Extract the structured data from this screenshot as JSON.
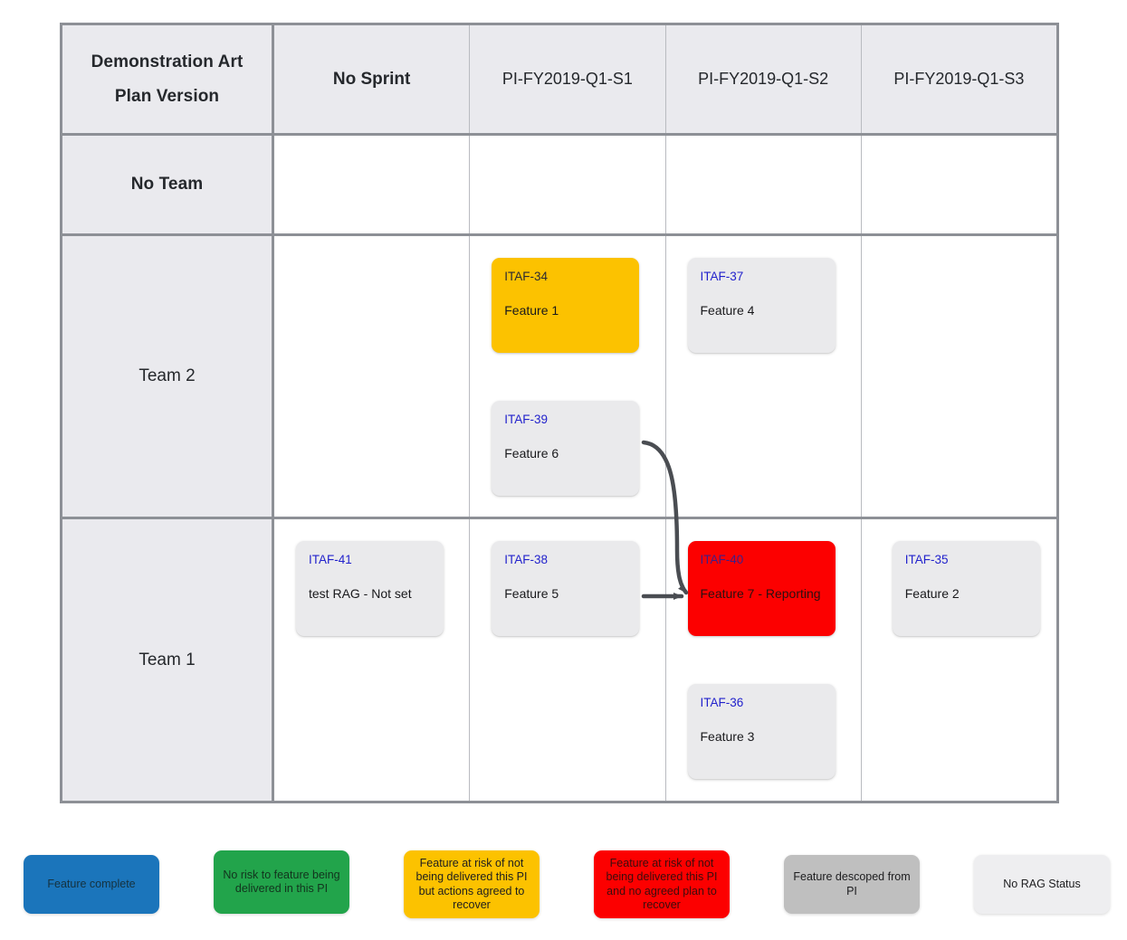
{
  "board": {
    "corner_header": {
      "line1": "Demonstration Art",
      "line2": "Plan Version"
    },
    "columns": [
      {
        "label": "No Sprint",
        "bold": true
      },
      {
        "label": "PI-FY2019-Q1-S1",
        "bold": false
      },
      {
        "label": "PI-FY2019-Q1-S2",
        "bold": false
      },
      {
        "label": "PI-FY2019-Q1-S3",
        "bold": false
      }
    ],
    "rows": [
      {
        "label": "No Team",
        "bold": true
      },
      {
        "label": "Team 2",
        "bold": false
      },
      {
        "label": "Team 1",
        "bold": false
      }
    ],
    "cards": [
      {
        "key": "ITAF-34",
        "title": "Feature 1",
        "status": "amber",
        "row": "Team 2",
        "column": "PI-FY2019-Q1-S1"
      },
      {
        "key": "ITAF-39",
        "title": "Feature 6",
        "status": "none",
        "row": "Team 2",
        "column": "PI-FY2019-Q1-S1"
      },
      {
        "key": "ITAF-37",
        "title": "Feature 4",
        "status": "none",
        "row": "Team 2",
        "column": "PI-FY2019-Q1-S2"
      },
      {
        "key": "ITAF-41",
        "title": "test RAG - Not set",
        "status": "none",
        "row": "Team 1",
        "column": "No Sprint"
      },
      {
        "key": "ITAF-38",
        "title": "Feature 5",
        "status": "none",
        "row": "Team 1",
        "column": "PI-FY2019-Q1-S1"
      },
      {
        "key": "ITAF-40",
        "title": "Feature 7 - Reporting",
        "status": "red",
        "row": "Team 1",
        "column": "PI-FY2019-Q1-S2"
      },
      {
        "key": "ITAF-36",
        "title": "Feature 3",
        "status": "none",
        "row": "Team 1",
        "column": "PI-FY2019-Q1-S2"
      },
      {
        "key": "ITAF-35",
        "title": "Feature 2",
        "status": "none",
        "row": "Team 1",
        "column": "PI-FY2019-Q1-S3"
      }
    ],
    "dependencies": [
      {
        "from": "ITAF-39",
        "to": "ITAF-40"
      },
      {
        "from": "ITAF-38",
        "to": "ITAF-40"
      }
    ]
  },
  "legend": {
    "items": [
      {
        "label": "Feature complete",
        "color": "#1b75bb",
        "text_color": "#15323f"
      },
      {
        "label": "No risk to feature being delivered in this PI",
        "color": "#22a44b",
        "text_color": "#12331d"
      },
      {
        "label": "Feature at risk of not being delivered this PI but actions agreed to recover",
        "color": "#fcc200",
        "text_color": "#1d1d1f"
      },
      {
        "label": "Feature at risk of not being delivered this PI and no agreed plan to recover",
        "color": "#fc0000",
        "text_color": "#3a0d0d"
      },
      {
        "label": "Feature descoped from PI",
        "color": "#bfbfbf",
        "text_color": "#1d1d1f"
      },
      {
        "label": "No RAG Status",
        "color": "#eeeef0",
        "text_color": "#1d1d1f"
      }
    ]
  },
  "colors": {
    "grid_border": "#8d9096",
    "grid_inner": "#b9bbc0",
    "header_bg": "#eaeaee",
    "card_bg": "#eaeaec",
    "card_key": "#2222cc",
    "arrow": "#4a4d52",
    "amber": "#fcc200",
    "red": "#fc0000"
  }
}
